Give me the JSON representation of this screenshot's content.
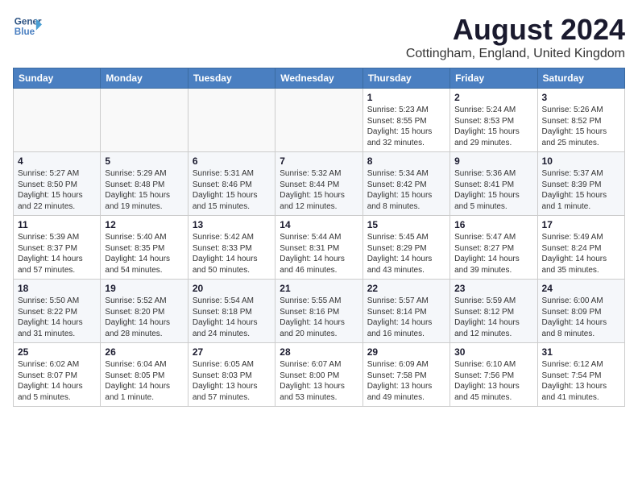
{
  "header": {
    "logo_line1": "General",
    "logo_line2": "Blue",
    "month_year": "August 2024",
    "location": "Cottingham, England, United Kingdom"
  },
  "weekdays": [
    "Sunday",
    "Monday",
    "Tuesday",
    "Wednesday",
    "Thursday",
    "Friday",
    "Saturday"
  ],
  "weeks": [
    [
      {
        "day": "",
        "info": ""
      },
      {
        "day": "",
        "info": ""
      },
      {
        "day": "",
        "info": ""
      },
      {
        "day": "",
        "info": ""
      },
      {
        "day": "1",
        "info": "Sunrise: 5:23 AM\nSunset: 8:55 PM\nDaylight: 15 hours\nand 32 minutes."
      },
      {
        "day": "2",
        "info": "Sunrise: 5:24 AM\nSunset: 8:53 PM\nDaylight: 15 hours\nand 29 minutes."
      },
      {
        "day": "3",
        "info": "Sunrise: 5:26 AM\nSunset: 8:52 PM\nDaylight: 15 hours\nand 25 minutes."
      }
    ],
    [
      {
        "day": "4",
        "info": "Sunrise: 5:27 AM\nSunset: 8:50 PM\nDaylight: 15 hours\nand 22 minutes."
      },
      {
        "day": "5",
        "info": "Sunrise: 5:29 AM\nSunset: 8:48 PM\nDaylight: 15 hours\nand 19 minutes."
      },
      {
        "day": "6",
        "info": "Sunrise: 5:31 AM\nSunset: 8:46 PM\nDaylight: 15 hours\nand 15 minutes."
      },
      {
        "day": "7",
        "info": "Sunrise: 5:32 AM\nSunset: 8:44 PM\nDaylight: 15 hours\nand 12 minutes."
      },
      {
        "day": "8",
        "info": "Sunrise: 5:34 AM\nSunset: 8:42 PM\nDaylight: 15 hours\nand 8 minutes."
      },
      {
        "day": "9",
        "info": "Sunrise: 5:36 AM\nSunset: 8:41 PM\nDaylight: 15 hours\nand 5 minutes."
      },
      {
        "day": "10",
        "info": "Sunrise: 5:37 AM\nSunset: 8:39 PM\nDaylight: 15 hours\nand 1 minute."
      }
    ],
    [
      {
        "day": "11",
        "info": "Sunrise: 5:39 AM\nSunset: 8:37 PM\nDaylight: 14 hours\nand 57 minutes."
      },
      {
        "day": "12",
        "info": "Sunrise: 5:40 AM\nSunset: 8:35 PM\nDaylight: 14 hours\nand 54 minutes."
      },
      {
        "day": "13",
        "info": "Sunrise: 5:42 AM\nSunset: 8:33 PM\nDaylight: 14 hours\nand 50 minutes."
      },
      {
        "day": "14",
        "info": "Sunrise: 5:44 AM\nSunset: 8:31 PM\nDaylight: 14 hours\nand 46 minutes."
      },
      {
        "day": "15",
        "info": "Sunrise: 5:45 AM\nSunset: 8:29 PM\nDaylight: 14 hours\nand 43 minutes."
      },
      {
        "day": "16",
        "info": "Sunrise: 5:47 AM\nSunset: 8:27 PM\nDaylight: 14 hours\nand 39 minutes."
      },
      {
        "day": "17",
        "info": "Sunrise: 5:49 AM\nSunset: 8:24 PM\nDaylight: 14 hours\nand 35 minutes."
      }
    ],
    [
      {
        "day": "18",
        "info": "Sunrise: 5:50 AM\nSunset: 8:22 PM\nDaylight: 14 hours\nand 31 minutes."
      },
      {
        "day": "19",
        "info": "Sunrise: 5:52 AM\nSunset: 8:20 PM\nDaylight: 14 hours\nand 28 minutes."
      },
      {
        "day": "20",
        "info": "Sunrise: 5:54 AM\nSunset: 8:18 PM\nDaylight: 14 hours\nand 24 minutes."
      },
      {
        "day": "21",
        "info": "Sunrise: 5:55 AM\nSunset: 8:16 PM\nDaylight: 14 hours\nand 20 minutes."
      },
      {
        "day": "22",
        "info": "Sunrise: 5:57 AM\nSunset: 8:14 PM\nDaylight: 14 hours\nand 16 minutes."
      },
      {
        "day": "23",
        "info": "Sunrise: 5:59 AM\nSunset: 8:12 PM\nDaylight: 14 hours\nand 12 minutes."
      },
      {
        "day": "24",
        "info": "Sunrise: 6:00 AM\nSunset: 8:09 PM\nDaylight: 14 hours\nand 8 minutes."
      }
    ],
    [
      {
        "day": "25",
        "info": "Sunrise: 6:02 AM\nSunset: 8:07 PM\nDaylight: 14 hours\nand 5 minutes."
      },
      {
        "day": "26",
        "info": "Sunrise: 6:04 AM\nSunset: 8:05 PM\nDaylight: 14 hours\nand 1 minute."
      },
      {
        "day": "27",
        "info": "Sunrise: 6:05 AM\nSunset: 8:03 PM\nDaylight: 13 hours\nand 57 minutes."
      },
      {
        "day": "28",
        "info": "Sunrise: 6:07 AM\nSunset: 8:00 PM\nDaylight: 13 hours\nand 53 minutes."
      },
      {
        "day": "29",
        "info": "Sunrise: 6:09 AM\nSunset: 7:58 PM\nDaylight: 13 hours\nand 49 minutes."
      },
      {
        "day": "30",
        "info": "Sunrise: 6:10 AM\nSunset: 7:56 PM\nDaylight: 13 hours\nand 45 minutes."
      },
      {
        "day": "31",
        "info": "Sunrise: 6:12 AM\nSunset: 7:54 PM\nDaylight: 13 hours\nand 41 minutes."
      }
    ]
  ]
}
